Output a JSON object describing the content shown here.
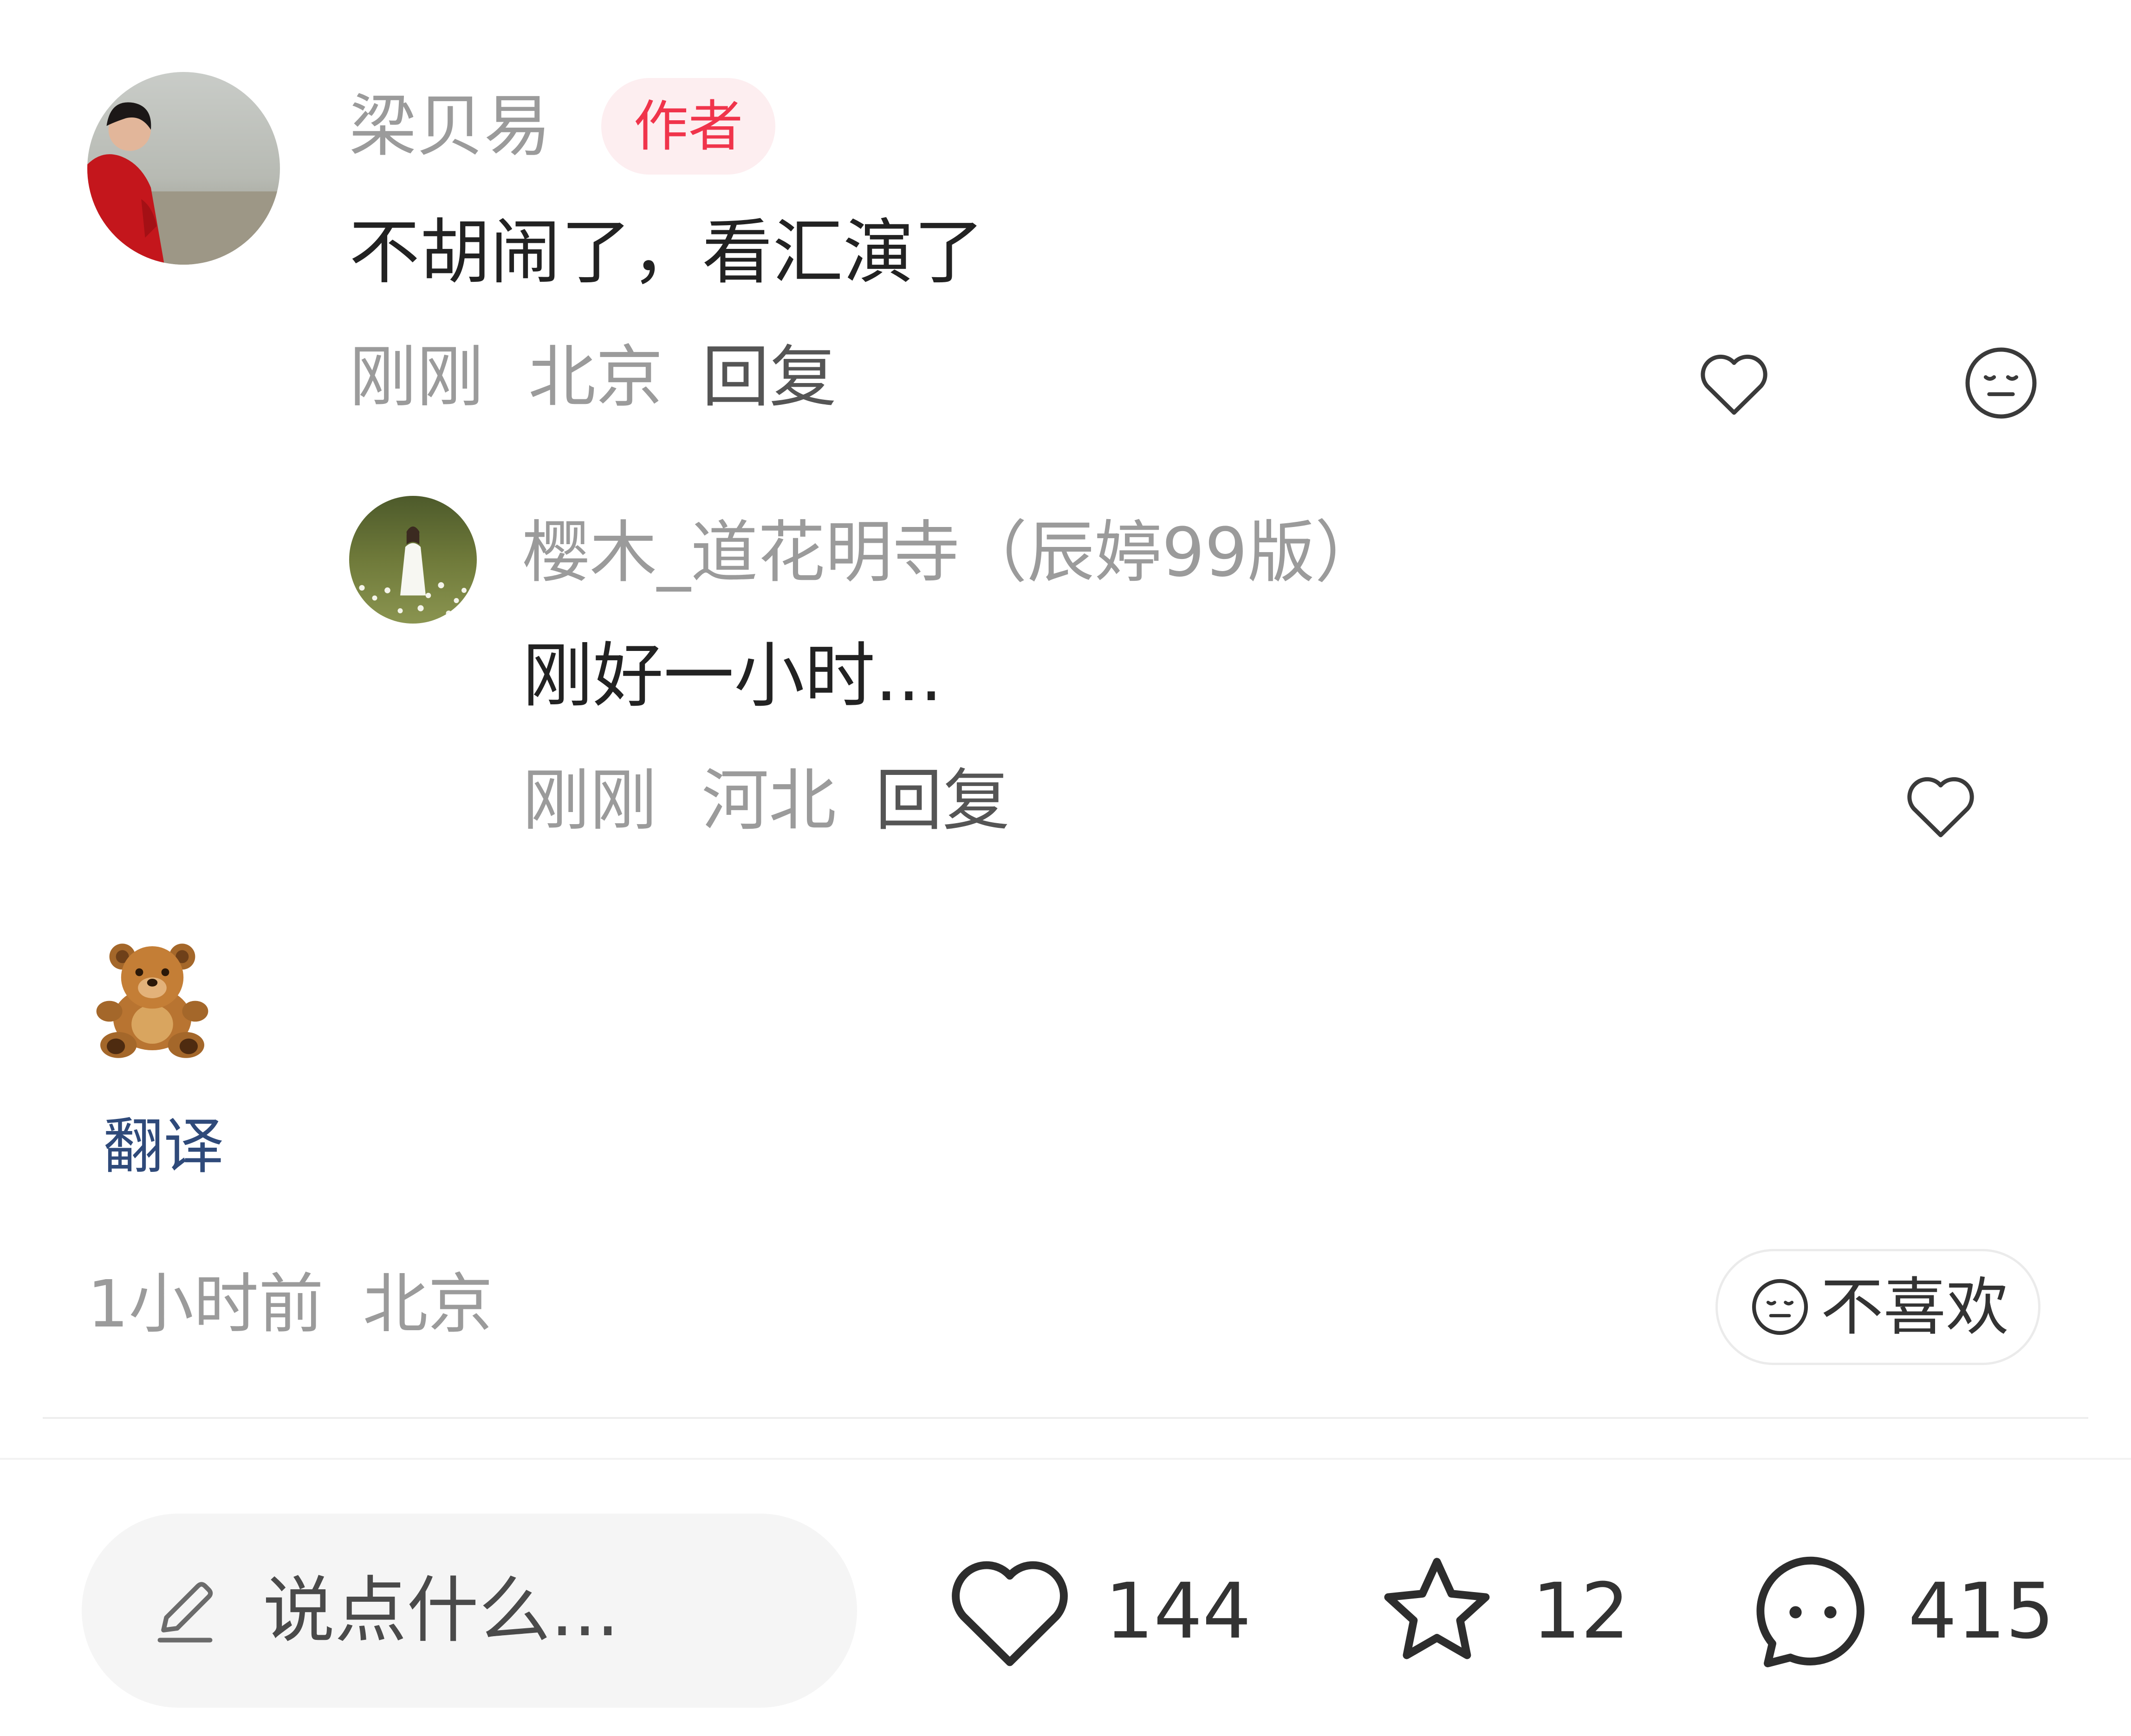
{
  "comment": {
    "author": "梁贝易",
    "author_badge": "作者",
    "text": "不胡闹了，看汇演了",
    "time": "刚刚",
    "location": "北京",
    "reply_label": "回复"
  },
  "reply": {
    "author": "樱木_道花明寺（辰婷99版）",
    "text": "刚好一小时...",
    "time": "刚刚",
    "location": "河北",
    "reply_label": "回复"
  },
  "post": {
    "emoji": "🧸",
    "translate_label": "翻译",
    "time": "1小时前",
    "location": "北京",
    "dislike_label": "不喜欢"
  },
  "bottom_bar": {
    "input_placeholder": "说点什么...",
    "likes": "144",
    "favorites": "12",
    "comments": "415"
  },
  "icons": {
    "comment_like": "heart-outline-icon",
    "comment_dislike": "dislike-face-icon",
    "reply_like": "heart-outline-icon",
    "input": "pencil-icon",
    "likes": "heart-outline-icon",
    "favorites": "star-outline-icon",
    "comments": "chat-bubble-icon"
  },
  "colors": {
    "author_badge_bg": "#fdeef0",
    "author_badge_text": "#f0344b",
    "translate_link": "#2f4a7a",
    "muted_text": "#9b9b9b"
  }
}
